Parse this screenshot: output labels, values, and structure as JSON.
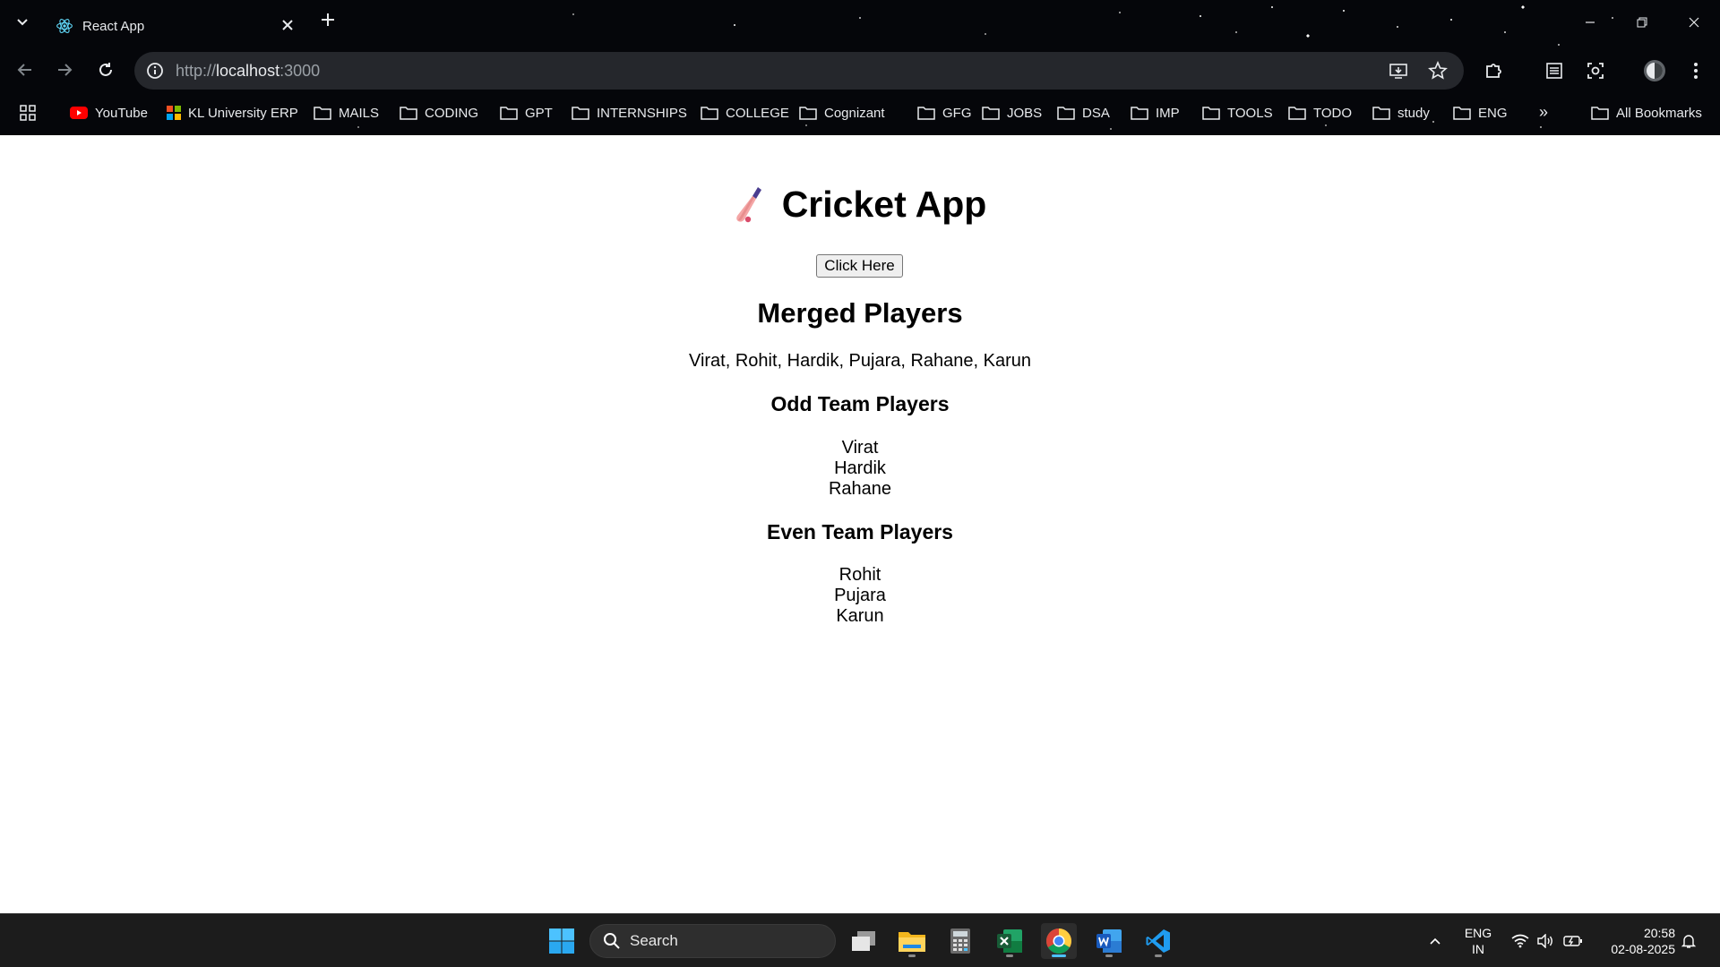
{
  "browser": {
    "tab_title": "React App",
    "url_scheme": "http://",
    "url_host": "localhost",
    "url_port": ":3000",
    "bookmarks": [
      {
        "label": "YouTube",
        "icon": "youtube-icon"
      },
      {
        "label": "KL University ERP",
        "icon": "erp-icon"
      },
      {
        "label": "MAILS",
        "icon": "folder-icon"
      },
      {
        "label": "CODING",
        "icon": "folder-icon"
      },
      {
        "label": "GPT",
        "icon": "folder-icon"
      },
      {
        "label": "INTERNSHIPS",
        "icon": "folder-icon"
      },
      {
        "label": "COLLEGE",
        "icon": "folder-icon"
      },
      {
        "label": "Cognizant",
        "icon": "folder-icon"
      },
      {
        "label": "GFG",
        "icon": "folder-icon"
      },
      {
        "label": "JOBS",
        "icon": "folder-icon"
      },
      {
        "label": "DSA",
        "icon": "folder-icon"
      },
      {
        "label": "IMP",
        "icon": "folder-icon"
      },
      {
        "label": "TOOLS",
        "icon": "folder-icon"
      },
      {
        "label": "TODO",
        "icon": "folder-icon"
      },
      {
        "label": "study",
        "icon": "folder-icon"
      },
      {
        "label": "ENG",
        "icon": "folder-icon"
      }
    ],
    "all_bookmarks": "All Bookmarks"
  },
  "app": {
    "title": "Cricket App",
    "title_icon": "cricket-bat-icon",
    "button_label": "Click Here",
    "merged_heading": "Merged Players",
    "merged_players": "Virat, Rohit, Hardik, Pujara, Rahane, Karun",
    "odd_heading": "Odd Team Players",
    "odd_players": [
      "Virat",
      "Hardik",
      "Rahane"
    ],
    "even_heading": "Even Team Players",
    "even_players": [
      "Rohit",
      "Pujara",
      "Karun"
    ]
  },
  "taskbar": {
    "search_label": "Search",
    "lang_line1": "ENG",
    "lang_line2": "IN",
    "time": "20:58",
    "date": "02-08-2025"
  },
  "colors": {
    "chrome_bg": "#05060a",
    "taskbar_bg": "#1c1c1c",
    "active_indicator": "#4cc2ff"
  }
}
